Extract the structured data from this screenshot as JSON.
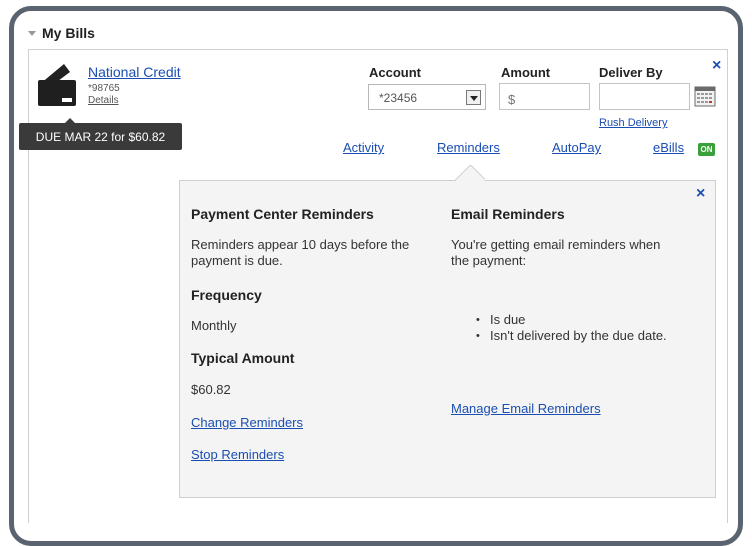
{
  "section": {
    "title": "My Bills"
  },
  "bill": {
    "payee_name": "National Credit",
    "account_number": "*98765",
    "details_label": "Details",
    "due_label": "DUE MAR 22 for $60.82"
  },
  "form": {
    "account_label": "Account",
    "account_value": "*23456",
    "amount_label": "Amount",
    "amount_placeholder": "$",
    "deliver_by_label": "Deliver By",
    "rush_delivery": "Rush Delivery"
  },
  "tabs": {
    "activity": "Activity",
    "reminders": "Reminders",
    "autopay": "AutoPay",
    "ebills": "eBills",
    "ebills_status": "ON"
  },
  "close_glyph": "×",
  "reminders_panel": {
    "pc_title": "Payment Center Reminders",
    "pc_desc": "Reminders appear 10 days before the payment is due.",
    "frequency_label": "Frequency",
    "frequency_value": "Monthly",
    "typical_label": "Typical Amount",
    "typical_value": "$60.82",
    "change_link": "Change Reminders",
    "stop_link": "Stop Reminders",
    "email_title": "Email Reminders",
    "email_desc": "You're getting email reminders when the payment:",
    "email_bullets": [
      "Is due",
      "Isn't delivered by the due date."
    ],
    "manage_link": "Manage Email Reminders"
  },
  "colors": {
    "link": "#1a4eb2",
    "badge_dark": "#3a3a3a",
    "on_green": "#3aa03a",
    "frame": "#5a6470",
    "panel_bg": "#f4f4f4"
  },
  "icons": {
    "collapse": "triangle-down-icon",
    "payee": "credit-card-icon",
    "select": "dropdown-arrow-icon",
    "calendar": "calendar-icon",
    "close": "close-icon"
  }
}
